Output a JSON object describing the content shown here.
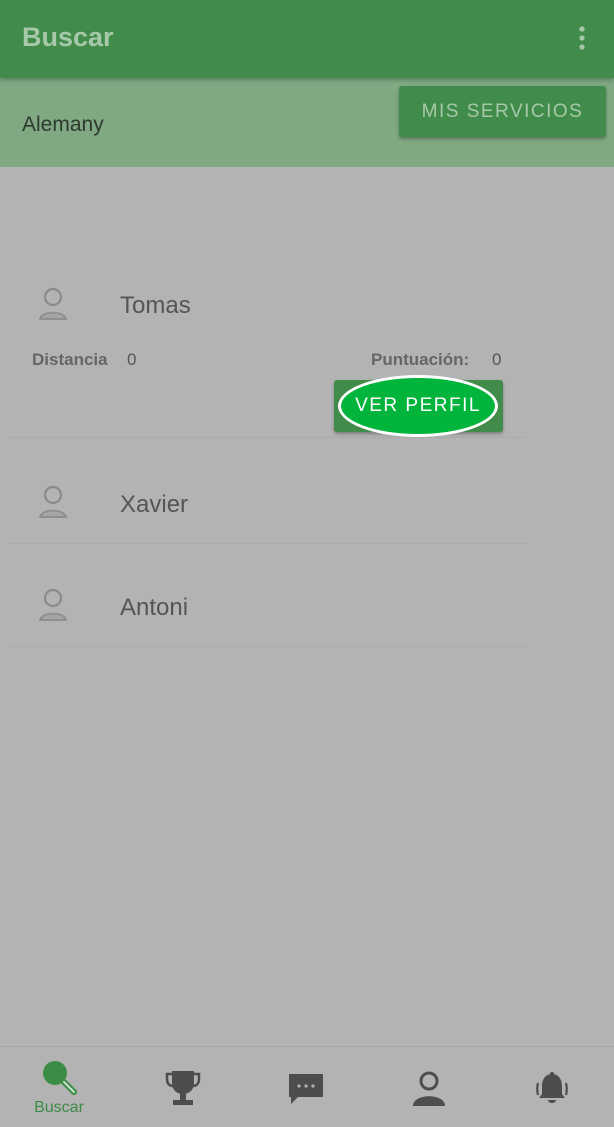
{
  "appbar": {
    "title": "Buscar",
    "menu_icon": "more-vert-icon"
  },
  "subbar": {
    "label": "Alemany",
    "button_label": "MIS SERVICIOS"
  },
  "results": [
    {
      "name": "Tomas",
      "distance_label": "Distancia",
      "distance_value": "0",
      "score_label": "Puntuación:",
      "score_value": "0",
      "button_label": "VER PERFIL"
    },
    {
      "name": "Xavier"
    },
    {
      "name": "Antoni"
    }
  ],
  "bottom_nav": [
    {
      "id": "buscar",
      "label": "Buscar",
      "icon": "search-icon",
      "active": true
    },
    {
      "id": "trophy",
      "icon": "trophy-icon"
    },
    {
      "id": "chat",
      "icon": "chat-icon"
    },
    {
      "id": "profile",
      "icon": "person-icon"
    },
    {
      "id": "notifications",
      "icon": "bell-icon"
    }
  ],
  "colors": {
    "primary": "#418c4a",
    "primary_text": "#a7c9aa",
    "highlight": "#00b43c",
    "background": "#b3b3b3"
  }
}
